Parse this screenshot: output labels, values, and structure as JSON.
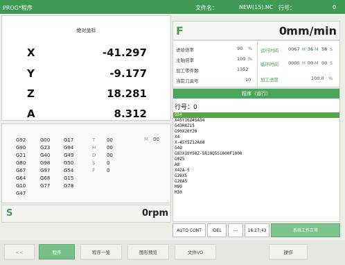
{
  "top": {
    "title": "PROG*程序",
    "file_label": "文件名：",
    "file_name": "NEW(15).NC",
    "line_label": "行号：",
    "line_value": "0"
  },
  "coords": {
    "header": "绝对坐标",
    "x": {
      "label": "X",
      "value": "-41.297"
    },
    "y": {
      "label": "Y",
      "value": "-9.177"
    },
    "z": {
      "label": "Z",
      "value": "18.281"
    },
    "a": {
      "label": "A",
      "value": "8.312"
    }
  },
  "modal_codes": {
    "col1": [
      "G92",
      "G90",
      "G21",
      "G80",
      "G67",
      "G64",
      "G10",
      "G47"
    ],
    "col2": [
      "G00",
      "G23",
      "G40",
      "G98",
      "G97",
      "G68",
      "G77"
    ],
    "col3": [
      "G17",
      "G94",
      "G49",
      "G50",
      "G54",
      "G15",
      "G78"
    ],
    "tl": [
      "T",
      "H",
      "D",
      "S",
      "F"
    ],
    "tv": [
      "00",
      "00",
      "00",
      "0",
      "0"
    ],
    "m_label": "M",
    "m_value": "00"
  },
  "spindle": {
    "label": "S",
    "value": "0",
    "unit": "rpm"
  },
  "feed": {
    "label": "F",
    "value": "0",
    "unit": "mm/min"
  },
  "stats": {
    "feed_rate": "进给倍率",
    "feed_rate_val": "90",
    "feed_unit": "%",
    "spindle_rate": "主轴倍率",
    "spindle_rate_val": "100",
    "spindle_unit": "%",
    "parts": "加工零件数",
    "parts_val": "1352",
    "tool": "当前刀具号",
    "tool_val": "10",
    "run_time": "运行时间",
    "run_h": "0067",
    "run_hlabel": "H",
    "run_m": "36",
    "run_mlabel": "M",
    "run_s": "58",
    "run_slabel": "S",
    "cycle_time": "循环时间",
    "cycle_h": "0000",
    "cycle_hlabel": "H",
    "cycle_m": "00",
    "cycle_mlabel": "M",
    "cycle_s": "00",
    "cycle_slabel": "S",
    "progress": "加工进度",
    "progress_val": "100.0",
    "progress_unit": "%"
  },
  "program": {
    "title": "程序（运行）",
    "line_no": "行号：0",
    "lines": [
      "G54",
      "X45Y10Z45A54",
      "G43H8Z15",
      "G90X20Y20",
      "X4",
      "X-45Y5Z12A88",
      "G49",
      "G83X10Y50Z-5R10Q5S1000F1000",
      "G0Z5",
      "A8",
      "X42A-5",
      "G28X5",
      "G28A5",
      "M99",
      "M30"
    ]
  },
  "status_bar": {
    "mode": "AUTO CONT",
    "state": "IDEL",
    "dash": "---",
    "time": "16:27:43",
    "msg": "系统工作正常"
  },
  "bottom_menu": [
    "<<",
    "程序",
    "程序一览",
    "图形预览",
    "文件I/O",
    "操作"
  ],
  "colors": {
    "accent": "#3f9a55",
    "highlight": "#5aa446"
  }
}
